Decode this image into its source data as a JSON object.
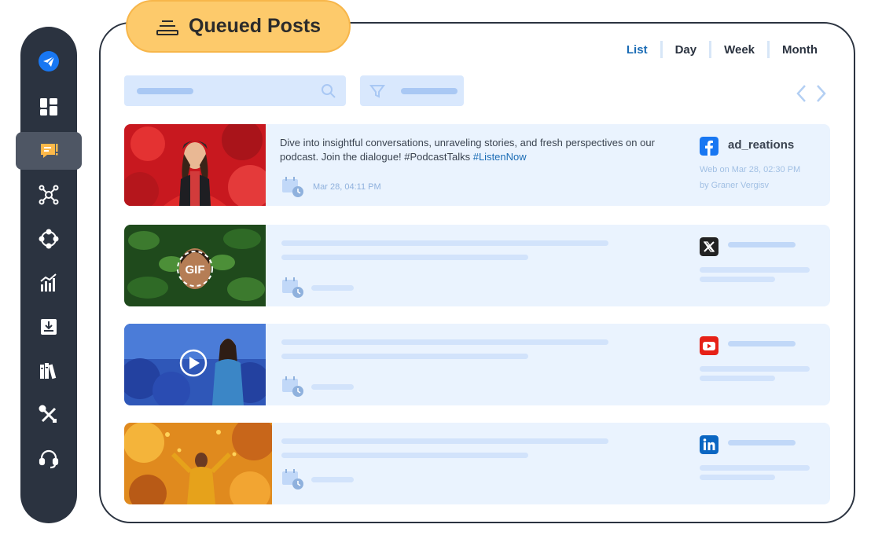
{
  "header": {
    "title": "Queued Posts"
  },
  "view_tabs": [
    "List",
    "Day",
    "Week",
    "Month"
  ],
  "active_tab": "List",
  "sidebar": {
    "items": [
      {
        "icon": "send-icon",
        "active": false
      },
      {
        "icon": "dashboard-icon",
        "active": false
      },
      {
        "icon": "posts-icon",
        "active": true
      },
      {
        "icon": "network-icon",
        "active": false
      },
      {
        "icon": "connections-icon",
        "active": false
      },
      {
        "icon": "analytics-icon",
        "active": false
      },
      {
        "icon": "inbox-icon",
        "active": false
      },
      {
        "icon": "library-icon",
        "active": false
      },
      {
        "icon": "tools-icon",
        "active": false
      },
      {
        "icon": "support-icon",
        "active": false
      }
    ]
  },
  "posts": [
    {
      "network": "facebook",
      "text_main": "Dive into insightful conversations, unraveling stories, and fresh perspectives on our podcast. Join the dialogue! #PodcastTalks ",
      "text_link": "#ListenNow",
      "scheduled": "Mar 28, 04:11 PM",
      "account": "ad_reations",
      "via": "Web on Mar 28, 02:30 PM",
      "author": "by Graner Vergisv",
      "thumb_badge": ""
    },
    {
      "network": "x",
      "thumb_badge": "GIF"
    },
    {
      "network": "youtube",
      "thumb_badge": "play"
    },
    {
      "network": "linkedin",
      "thumb_badge": ""
    }
  ],
  "colors": {
    "sidebar": "#2b3340",
    "accent": "#1b6cb5",
    "title_pill": "#fdca6b",
    "card": "#eaf3fe",
    "facebook": "#1877f2",
    "x": "#222222",
    "youtube": "#e62117",
    "linkedin": "#0a66c2"
  }
}
